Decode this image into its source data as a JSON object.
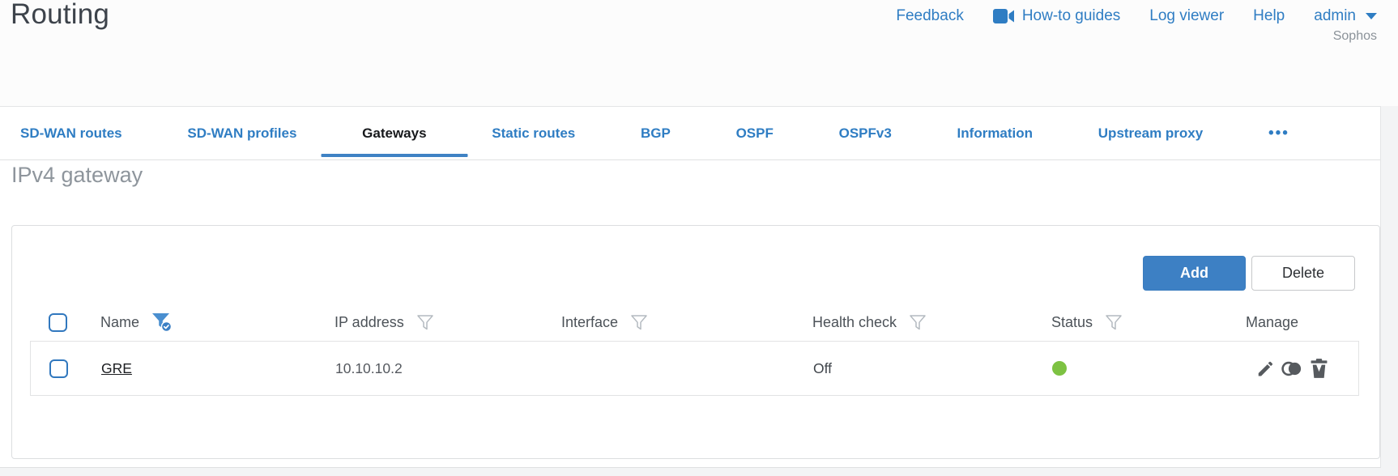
{
  "header": {
    "title": "Routing",
    "links": {
      "feedback": "Feedback",
      "howto": "How-to guides",
      "log_viewer": "Log viewer",
      "help": "Help",
      "user": "admin"
    },
    "brand": "Sophos"
  },
  "tabs": {
    "items": [
      {
        "label": "SD-WAN routes",
        "active": false
      },
      {
        "label": "SD-WAN profiles",
        "active": false
      },
      {
        "label": "Gateways",
        "active": true
      },
      {
        "label": "Static routes",
        "active": false
      },
      {
        "label": "BGP",
        "active": false
      },
      {
        "label": "OSPF",
        "active": false
      },
      {
        "label": "OSPFv3",
        "active": false
      },
      {
        "label": "Information",
        "active": false
      },
      {
        "label": "Upstream proxy",
        "active": false
      }
    ],
    "more": "•••"
  },
  "section": {
    "title": "IPv4 gateway"
  },
  "toolbar": {
    "add": "Add",
    "delete": "Delete"
  },
  "table": {
    "columns": [
      {
        "label": "Name",
        "filter": "active"
      },
      {
        "label": "IP address",
        "filter": "inactive"
      },
      {
        "label": "Interface",
        "filter": "inactive"
      },
      {
        "label": "Health check",
        "filter": "inactive"
      },
      {
        "label": "Status",
        "filter": "inactive"
      },
      {
        "label": "Manage",
        "filter": "none"
      }
    ],
    "rows": [
      {
        "name": "GRE",
        "ip_address": "10.10.10.2",
        "interface": "",
        "health_check": "Off",
        "status": "up",
        "status_color": "#7dc242",
        "manage_icons": [
          "edit-pencil",
          "clone",
          "delete-trash"
        ]
      }
    ]
  },
  "colors": {
    "accent_blue": "#2f7dc3",
    "button_blue": "#3d80c4",
    "active_tab_underline": "#3f82c4",
    "status_green": "#7dc242",
    "title_gray": "#3d434b",
    "section_title_gray": "#8e959c"
  }
}
